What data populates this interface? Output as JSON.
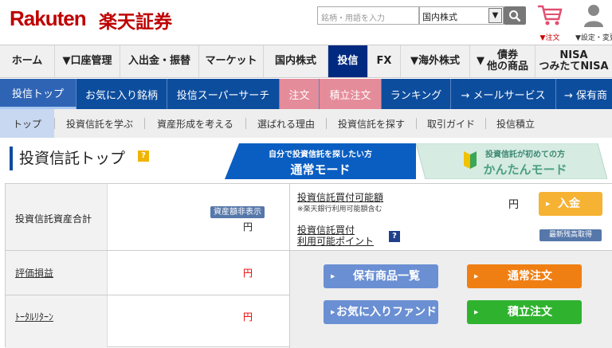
{
  "header": {
    "logo": "Rakuten",
    "logo_jp": "楽天証券",
    "search_placeholder": "銘柄・用語を入力",
    "market_select": "国内株式",
    "cart_label": "▼注文",
    "settings_label": "▼設定・変更"
  },
  "main_nav": [
    {
      "label": "ホーム"
    },
    {
      "label": "▼口座管理"
    },
    {
      "label": "入出金・振替"
    },
    {
      "label": "マーケット"
    },
    {
      "label": "国内株式"
    },
    {
      "label": "投信"
    },
    {
      "label": "FX"
    },
    {
      "label": "▼海外株式"
    },
    {
      "label_line1": "▼",
      "label_line2a": "債券",
      "label_line2b": "他の商品"
    },
    {
      "label_line1": "NISA",
      "label_line2": "つみたてNISA"
    }
  ],
  "sub_nav": [
    {
      "label": "投信トップ"
    },
    {
      "label": "お気に入り銘柄"
    },
    {
      "label": "投信スーパーサーチ"
    },
    {
      "label": "注文"
    },
    {
      "label": "積立注文"
    },
    {
      "label": "ランキング"
    },
    {
      "label": "→ メールサービス"
    },
    {
      "label": "→ 保有商"
    }
  ],
  "tert_nav": [
    {
      "label": "トップ"
    },
    {
      "label": "投資信託を学ぶ"
    },
    {
      "label": "資産形成を考える"
    },
    {
      "label": "選ばれる理由"
    },
    {
      "label": "投資信託を探す"
    },
    {
      "label": "取引ガイド"
    },
    {
      "label": "投信積立"
    }
  ],
  "page": {
    "title": "投資信託トップ",
    "help": "?",
    "mode_normal_small": "自分で投資信託を探したい方",
    "mode_normal_large": "通常モード",
    "mode_easy_small": "投資信託が初めての方",
    "mode_easy_large": "かんたんモード"
  },
  "summary": {
    "assets_label": "投資信託資産合計",
    "hide_badge": "資産額非表示",
    "assets_value": "円",
    "pl_label": "評価損益",
    "pl_value": "円",
    "total_label": "ﾄｰﾀﾙﾘﾀｰﾝ",
    "total_value": "円"
  },
  "buying_power": {
    "label": "投資信託買付可能額",
    "note": "※楽天銀行利用可能額含む",
    "value": "円",
    "deposit": "入金",
    "points_label1": "投資信託買付",
    "points_label2": "利用可能ポイント",
    "q": "?",
    "refresh": "最新残高取得"
  },
  "actions": {
    "holdings": "保有商品一覧",
    "normal_order": "通常注文",
    "favorites": "お気に入りファンド",
    "regular_order": "積立注文"
  },
  "colors": {
    "brand_red": "#bf0000",
    "nav_active": "#002a80",
    "subnav_bg": "#0d4d9e",
    "pink": "#e58c9a"
  }
}
